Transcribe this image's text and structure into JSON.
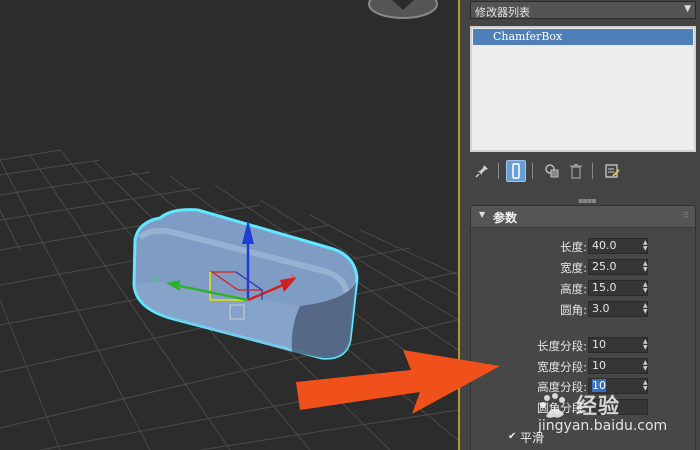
{
  "viewport": {
    "object_name": "ChamferBox"
  },
  "modifier_panel": {
    "modifier_list_label": "修改器列表",
    "stack_items": [
      "ChamferBox"
    ],
    "toolbar": {
      "icons": [
        "pin-stack-icon",
        "show-end-result-icon",
        "make-unique-icon",
        "remove-modifier-icon",
        "configure-modifier-sets-icon"
      ]
    }
  },
  "parameters": {
    "rollout_title": "参数",
    "fields": [
      {
        "label": "长度:",
        "value": "40.0"
      },
      {
        "label": "宽度:",
        "value": "25.0"
      },
      {
        "label": "高度:",
        "value": "15.0"
      },
      {
        "label": "圆角:",
        "value": "3.0"
      }
    ],
    "segments": [
      {
        "label": "长度分段:",
        "value": "10"
      },
      {
        "label": "宽度分段:",
        "value": "10"
      },
      {
        "label": "高度分段:",
        "value": "10"
      },
      {
        "label": "圆角分段:",
        "value": ""
      }
    ],
    "smooth_label": "平滑",
    "smooth_checked": true
  },
  "watermark": {
    "brand": "经验",
    "url": "jingyan.baidu.com"
  },
  "colors": {
    "accent_blue": "#4f7fb8",
    "selection_outline": "#5fe8ff",
    "object_color": "#7f9cc4",
    "arrow_orange": "#f0501a",
    "divider_gold": "#b8962e"
  }
}
